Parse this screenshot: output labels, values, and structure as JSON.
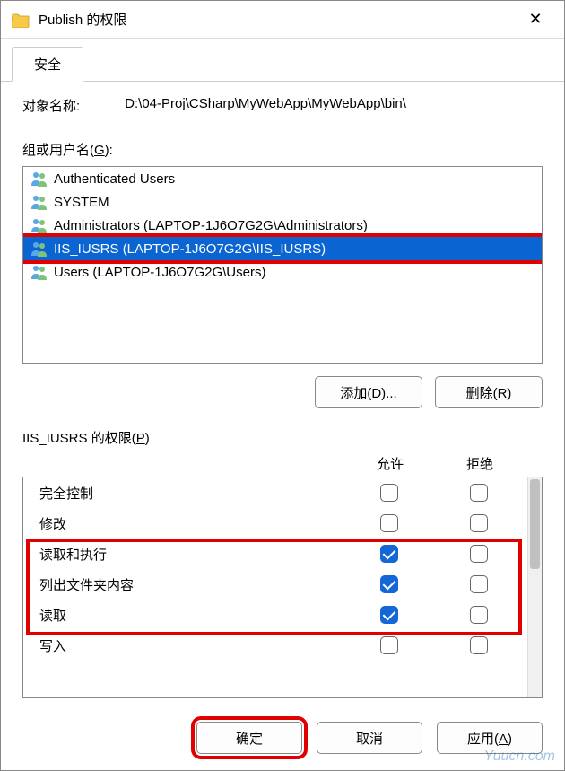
{
  "window": {
    "title": "Publish 的权限",
    "close": "✕"
  },
  "tabs": {
    "security": "安全"
  },
  "object": {
    "label": "对象名称:",
    "value": "D:\\04-Proj\\CSharp\\MyWebApp\\MyWebApp\\bin\\"
  },
  "groupLabel": {
    "pre": "组或用户名(",
    "u": "G",
    "post": "):"
  },
  "users": [
    {
      "name": "Authenticated Users",
      "selected": false,
      "highlight": false
    },
    {
      "name": "SYSTEM",
      "selected": false,
      "highlight": false
    },
    {
      "name": "Administrators (LAPTOP-1J6O7G2G\\Administrators)",
      "selected": false,
      "highlight": false
    },
    {
      "name": "IIS_IUSRS (LAPTOP-1J6O7G2G\\IIS_IUSRS)",
      "selected": true,
      "highlight": true
    },
    {
      "name": "Users (LAPTOP-1J6O7G2G\\Users)",
      "selected": false,
      "highlight": false
    }
  ],
  "buttons": {
    "add": {
      "pre": "添加(",
      "u": "D",
      "post": ")..."
    },
    "remove": {
      "pre": "删除(",
      "u": "R",
      "post": ")"
    }
  },
  "permLabel": {
    "pre": "IIS_IUSRS 的权限(",
    "u": "P",
    "post": ")"
  },
  "permHeaders": {
    "allow": "允许",
    "deny": "拒绝"
  },
  "permissions": [
    {
      "name": "完全控制",
      "allow": false,
      "deny": false
    },
    {
      "name": "修改",
      "allow": false,
      "deny": false
    },
    {
      "name": "读取和执行",
      "allow": true,
      "deny": false
    },
    {
      "name": "列出文件夹内容",
      "allow": true,
      "deny": false
    },
    {
      "name": "读取",
      "allow": true,
      "deny": false
    },
    {
      "name": "写入",
      "allow": false,
      "deny": false
    }
  ],
  "dlg": {
    "ok": "确定",
    "cancel": "取消",
    "apply": {
      "pre": "应用(",
      "u": "A",
      "post": ")"
    }
  },
  "watermark": "Yuucn.com"
}
